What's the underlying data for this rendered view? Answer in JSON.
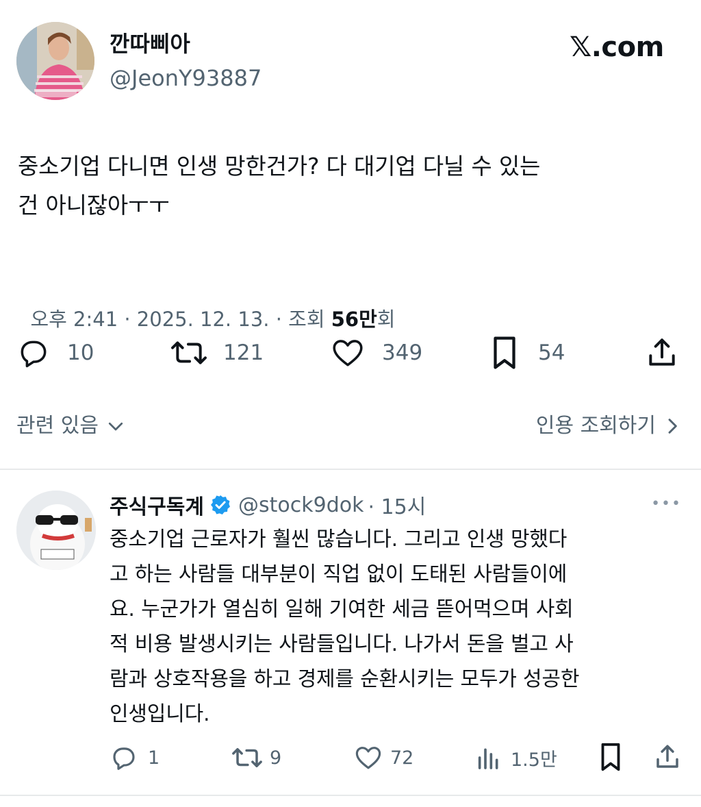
{
  "main_tweet": {
    "display_name": "깐따삐아",
    "handle": "@JeonY93887",
    "brand": "𝕏.com",
    "text_lines": [
      "중소기업 다니면 인생 망한건가? 다 대기업 다닐 수 있는",
      "건 아니잖아ㅜㅜ"
    ],
    "meta": {
      "time": "오후 2:41 · 2025. 12. 13. · 조회 ",
      "views": "56만",
      "views_suffix": "회"
    },
    "stats": {
      "replies": "10",
      "retweets": "121",
      "likes": "349",
      "bookmarks": "54"
    },
    "related_label": "관련 있음",
    "quotes_label": "인용 조회하기"
  },
  "reply": {
    "display_name": "주식구독계",
    "handle": "@stock9dok",
    "time": "· 15시",
    "more": "•••",
    "text_lines": [
      "중소기업 근로자가 훨씬 많습니다. 그리고 인생 망했다",
      "고 하는 사람들 대부분이 직업 없이 도태된 사람들이에",
      "요. 누군가가 열심히 일해 기여한 세금 뜯어먹으며 사회",
      "적 비용 발생시키는 사람들입니다. 나가서 돈을 벌고 사",
      "람과 상호작용을 하고 경제를 순환시키는 모두가 성공한",
      "인생입니다."
    ],
    "stats": {
      "replies": "1",
      "retweets": "9",
      "likes": "72",
      "views": "1.5만"
    }
  },
  "colors": {
    "text": "#0f1419",
    "muted": "#536471",
    "verified": "#1d9bf0",
    "divider": "#e7e9ea"
  }
}
